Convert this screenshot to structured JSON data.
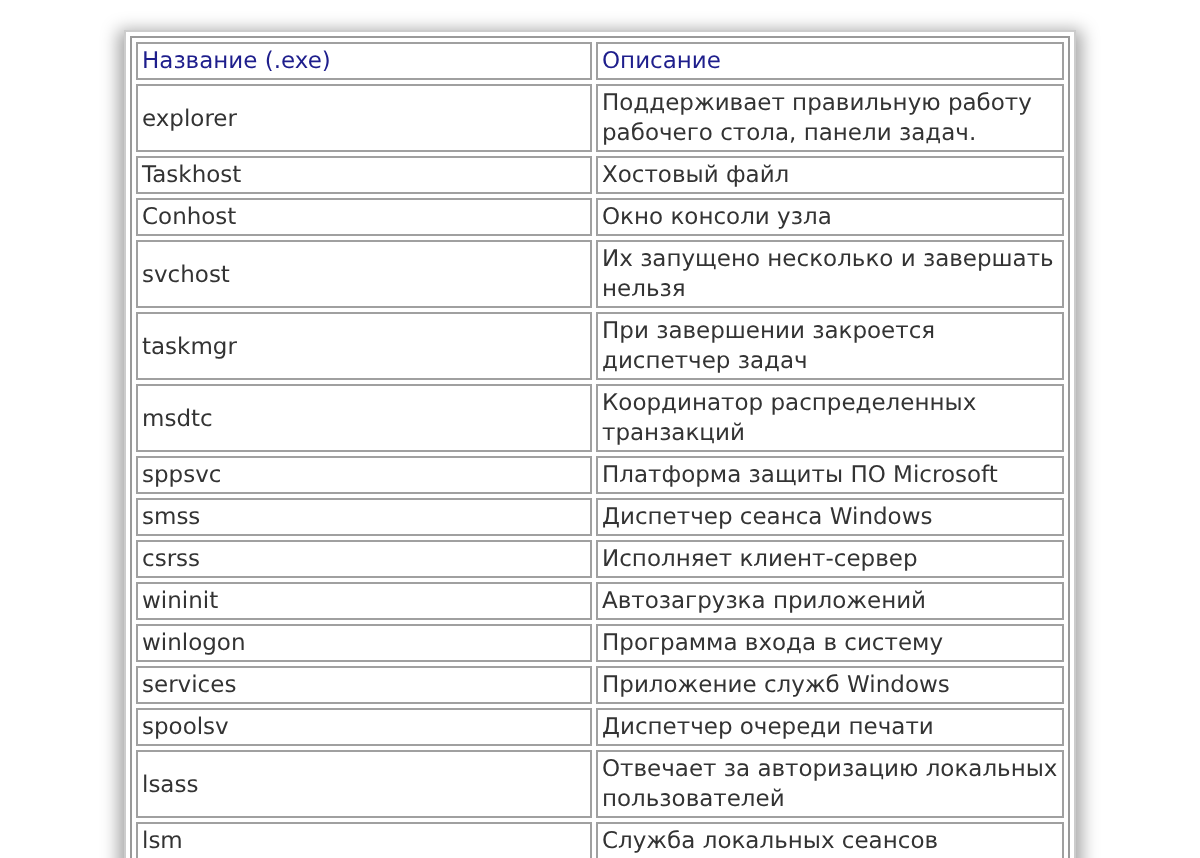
{
  "table": {
    "columns": [
      "Название (.exe)",
      "Описание"
    ],
    "rows": [
      [
        "explorer",
        "Поддерживает правильную работу рабочего стола, панели задач."
      ],
      [
        "Taskhost",
        "Хостовый файл"
      ],
      [
        "Conhost",
        "Окно консоли узла"
      ],
      [
        "svchost",
        "Их запущено несколько и завершать нельзя"
      ],
      [
        "taskmgr",
        "При завершении закроется диспетчер задач"
      ],
      [
        "msdtc",
        "Координатор распределенных транзакций"
      ],
      [
        "sppsvc",
        "Платформа защиты ПО Microsoft"
      ],
      [
        "smss",
        "Диспетчер сеанса Windows"
      ],
      [
        "csrss",
        "Исполняет клиент-сервер"
      ],
      [
        "wininit",
        "Автозагрузка приложений"
      ],
      [
        "winlogon",
        "Программа входа в систему"
      ],
      [
        "services",
        "Приложение служб Windows"
      ],
      [
        "spoolsv",
        "Диспетчер очереди печати"
      ],
      [
        "lsass",
        "Отвечает за авторизацию локальных пользователей"
      ],
      [
        "lsm",
        "Служба локальных сеансов"
      ]
    ]
  }
}
